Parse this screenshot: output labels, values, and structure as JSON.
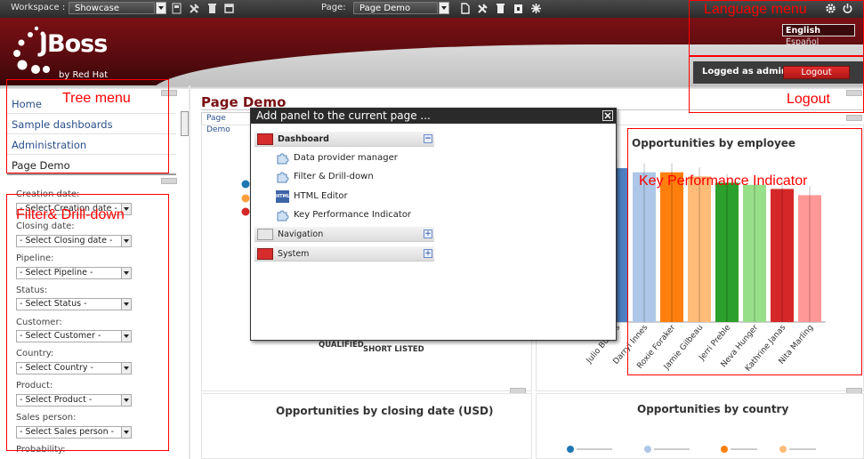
{
  "topbar": {
    "workspace_label": "Workspace :",
    "workspace_value": "Showcase",
    "page_label": "Page:",
    "page_value": "Page Demo"
  },
  "header": {
    "logo_text": "JBoss",
    "logo_sub": "by Red Hat",
    "language_en": "English",
    "language_es": "Español",
    "logged_as": "Logged as admin",
    "logout_label": "Logout"
  },
  "tree_menu": {
    "items": [
      "Home",
      "Sample dashboards",
      "Administration",
      "Page Demo"
    ]
  },
  "filters": [
    {
      "label": "Creation date:",
      "value": "- Select Creation date -"
    },
    {
      "label": "Closing date:",
      "value": "- Select Closing date -"
    },
    {
      "label": "Pipeline:",
      "value": "- Select Pipeline -"
    },
    {
      "label": "Status:",
      "value": "- Select Status -"
    },
    {
      "label": "Customer:",
      "value": "- Select Customer -"
    },
    {
      "label": "Country:",
      "value": "- Select Country -"
    },
    {
      "label": "Product:",
      "value": "- Select Product -"
    },
    {
      "label": "Sales person:",
      "value": "- Select Sales person -"
    },
    {
      "label": "Probability:",
      "value": ""
    }
  ],
  "main": {
    "page_title": "Page Demo",
    "breadcrumb": "Page Demo",
    "qualified_label": "QUALIFIED",
    "short_listed_label": "SHORT LISTED"
  },
  "modal": {
    "title": "Add panel to the current page ...",
    "groups": [
      {
        "name": "Dashboard",
        "expanded": true,
        "toggle": "−",
        "items": [
          "Data provider manager",
          "Filter & Drill-down",
          "HTML Editor",
          "Key Performance Indicator"
        ]
      },
      {
        "name": "Navigation",
        "expanded": false,
        "toggle": "+"
      },
      {
        "name": "System",
        "expanded": false,
        "toggle": "+"
      }
    ],
    "html_icon_text": "HTML"
  },
  "annotations": {
    "language_menu": "Language menu",
    "tree_menu": "Tree menu",
    "logout": "Logout",
    "filter": "Filter& Drill-down",
    "kpi": "Key Performance Indicator"
  },
  "chart_data": [
    {
      "type": "bar",
      "title": "Opportunities by employee",
      "categories": [
        "Julio Burgos",
        "Darryl Innes",
        "Roxie Foraker",
        "Jamie Gilbeau",
        "Jerri Preble",
        "Neva Hunger",
        "Kathrine Janas",
        "Nita Marling"
      ],
      "values": [
        0.74,
        0.72,
        0.72,
        0.7,
        0.67,
        0.66,
        0.64,
        0.61
      ],
      "colors": [
        "#4e7fc1",
        "#aec7e8",
        "#ff7f0e",
        "#ffbb78",
        "#2ca02c",
        "#98df8a",
        "#d62728",
        "#ff9896"
      ]
    },
    {
      "type": "pie",
      "title": "Opportunities by closing date (USD)"
    },
    {
      "type": "bar",
      "title": "Opportunities by country"
    }
  ],
  "colors": {
    "header_red": "#7a1014",
    "annotation_red": "#ff0000",
    "logout_button": "#c81e1e"
  }
}
